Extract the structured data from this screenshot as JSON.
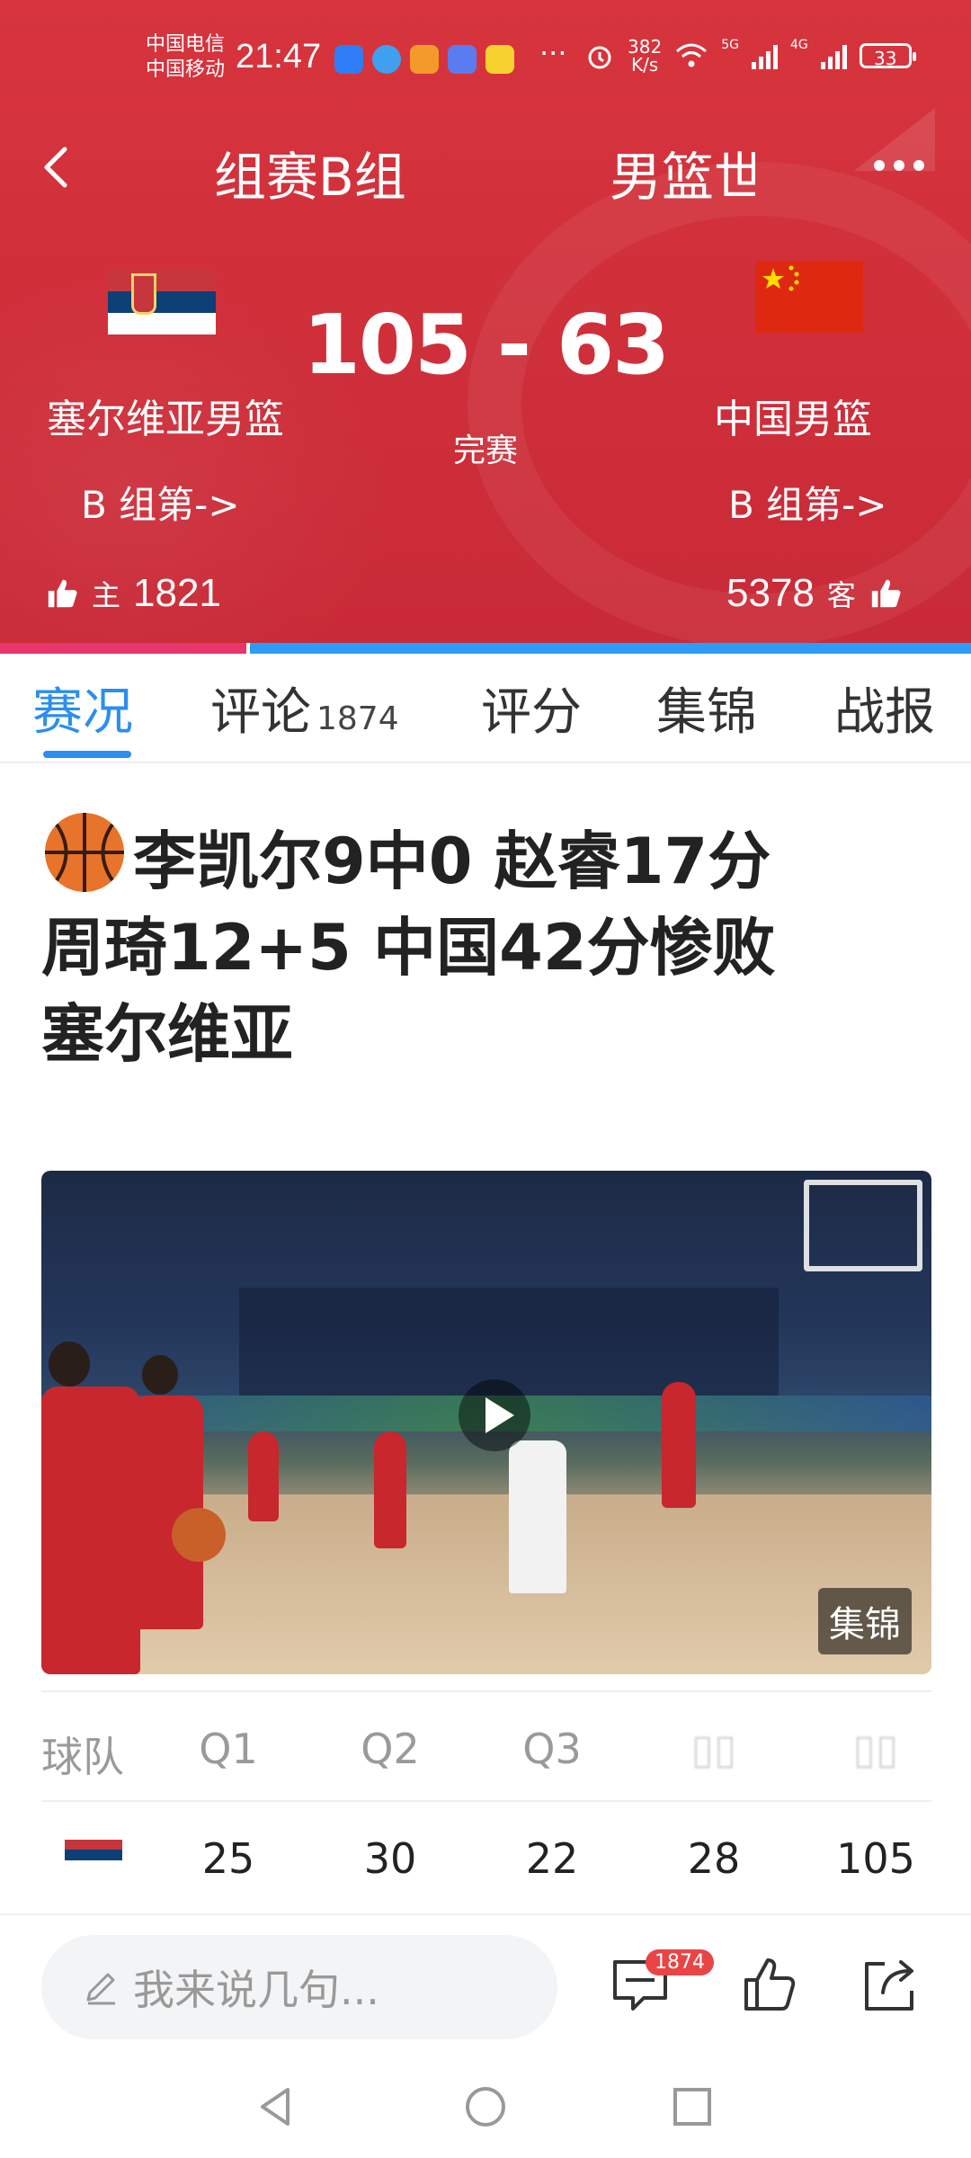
{
  "status_bar": {
    "carrier1": "中国电信",
    "carrier2": "中国移动",
    "time": "21:47",
    "more": "···",
    "net_speed_value": "382",
    "net_speed_unit": "K/s",
    "network1": "5G",
    "network2": "4G",
    "battery": "33"
  },
  "nav": {
    "title_left": "组赛B组",
    "title_right": "男篮世"
  },
  "match": {
    "score": "105 - 63",
    "status": "完赛",
    "home": {
      "name": "塞尔维亚男篮",
      "rank": "B 组第->",
      "likes": "1821",
      "tag": "主"
    },
    "away": {
      "name": "中国男篮",
      "rank": "B 组第->",
      "likes": "5378",
      "tag": "客"
    },
    "home_like_share": 0.254
  },
  "tabs": [
    {
      "label": "赛况",
      "count": ""
    },
    {
      "label": "评论",
      "count": "1874"
    },
    {
      "label": "评分",
      "count": ""
    },
    {
      "label": "集锦",
      "count": ""
    },
    {
      "label": "战报",
      "count": ""
    }
  ],
  "article": {
    "headline_line1": "李凯尔9中0 赵睿17分",
    "headline_line2": "周琦12+5 中国42分惨败",
    "headline_line3": "塞尔维亚",
    "video_badge": "集锦"
  },
  "score_table": {
    "headers": [
      "球队",
      "Q1",
      "Q2",
      "Q3",
      "",
      ""
    ],
    "rows": [
      {
        "q1": "25",
        "q2": "30",
        "q3": "22",
        "q4": "28",
        "total": "105"
      }
    ]
  },
  "comment_bar": {
    "placeholder": "我来说几句...",
    "comment_count": "1874"
  },
  "colors": {
    "header_red": "#d7343d",
    "home_bar": "#e8356b",
    "away_bar": "#2d9cf5",
    "accent_blue": "#2b8ef0"
  }
}
